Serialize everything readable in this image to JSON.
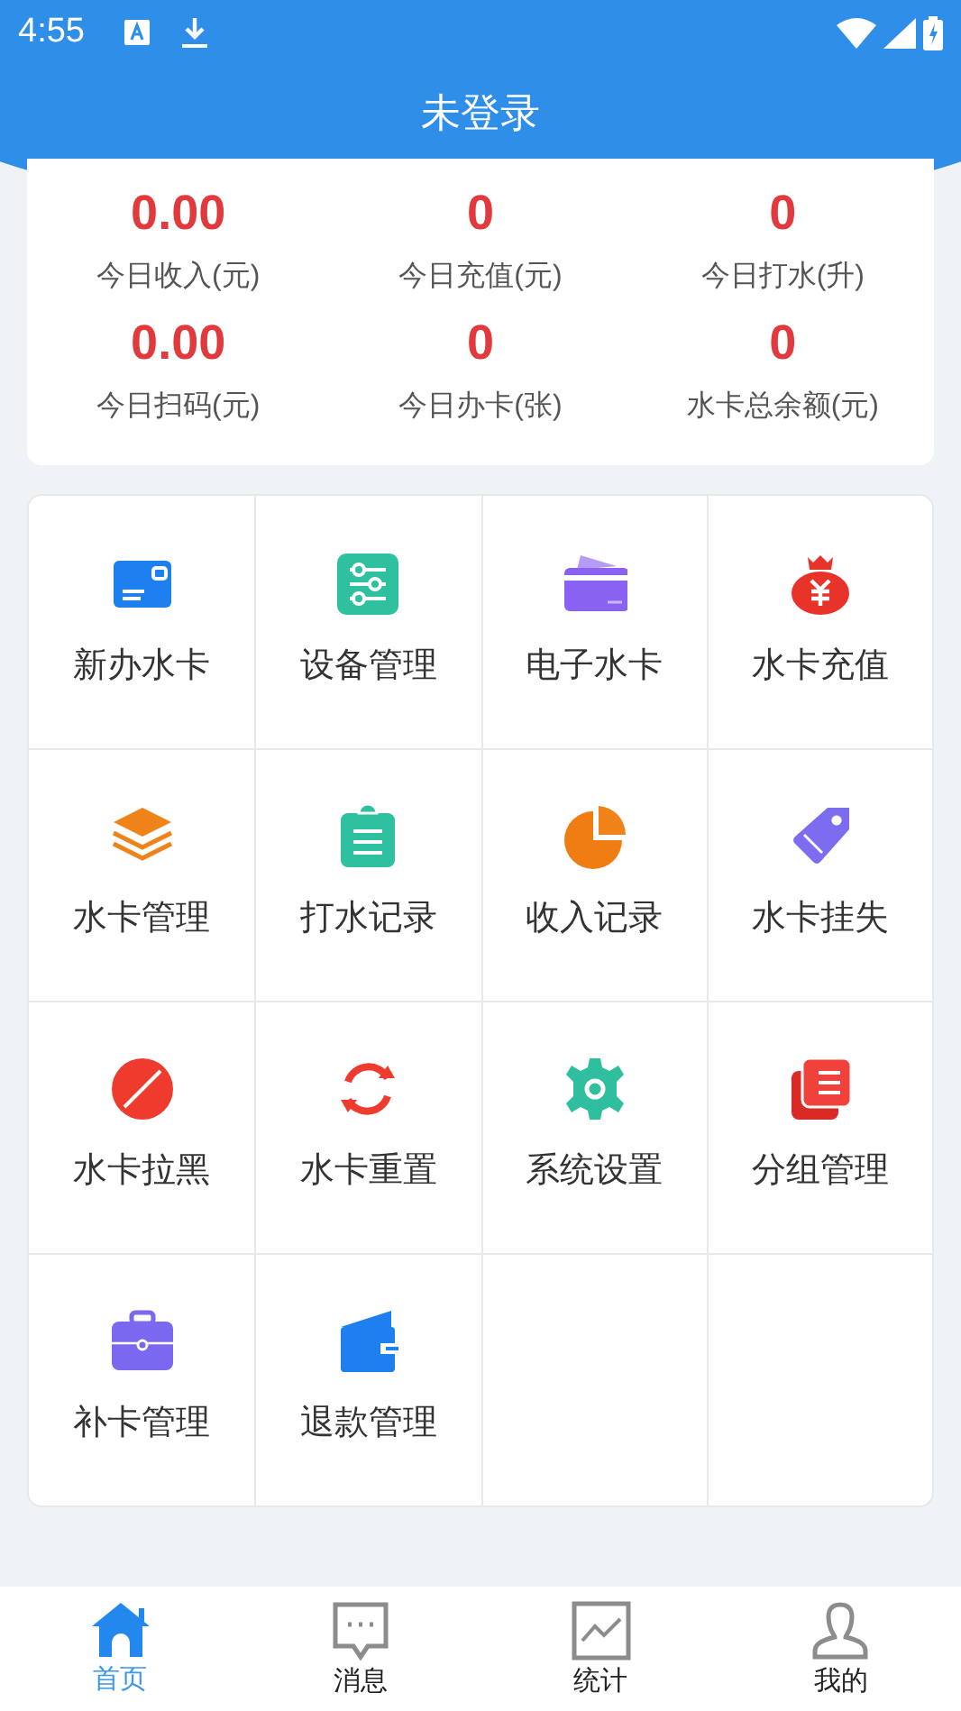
{
  "status_bar": {
    "time": "4:55"
  },
  "header": {
    "title": "未登录"
  },
  "stats": [
    {
      "value": "0.00",
      "label": "今日收入(元)"
    },
    {
      "value": "0",
      "label": "今日充值(元)"
    },
    {
      "value": "0",
      "label": "今日打水(升)"
    },
    {
      "value": "0.00",
      "label": "今日扫码(元)"
    },
    {
      "value": "0",
      "label": "今日办卡(张)"
    },
    {
      "value": "0",
      "label": "水卡总余额(元)"
    }
  ],
  "menu": [
    {
      "label": "新办水卡"
    },
    {
      "label": "设备管理"
    },
    {
      "label": "电子水卡"
    },
    {
      "label": "水卡充值"
    },
    {
      "label": "水卡管理"
    },
    {
      "label": "打水记录"
    },
    {
      "label": "收入记录"
    },
    {
      "label": "水卡挂失"
    },
    {
      "label": "水卡拉黑"
    },
    {
      "label": "水卡重置"
    },
    {
      "label": "系统设置"
    },
    {
      "label": "分组管理"
    },
    {
      "label": "补卡管理"
    },
    {
      "label": "退款管理"
    }
  ],
  "tab_bar": [
    {
      "label": "首页",
      "selected": true
    },
    {
      "label": "消息",
      "selected": false
    },
    {
      "label": "统计",
      "selected": false
    },
    {
      "label": "我的",
      "selected": false
    }
  ]
}
